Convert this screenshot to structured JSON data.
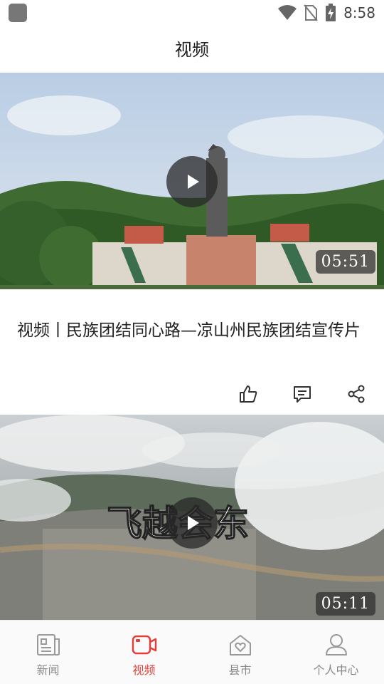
{
  "status": {
    "time": "8:58"
  },
  "header": {
    "title": "视频"
  },
  "videos": [
    {
      "title": "视频丨民族团结同心路—凉山州民族团结宣传片",
      "duration": "05:51"
    },
    {
      "overlay_text": "飞越会东",
      "duration": "05:11"
    }
  ],
  "nav": {
    "items": [
      {
        "label": "新闻",
        "icon": "news-icon"
      },
      {
        "label": "视频",
        "icon": "video-icon",
        "active": true
      },
      {
        "label": "县市",
        "icon": "county-home-icon"
      },
      {
        "label": "个人中心",
        "icon": "profile-icon"
      }
    ]
  },
  "colors": {
    "accent": "#e0403c"
  }
}
